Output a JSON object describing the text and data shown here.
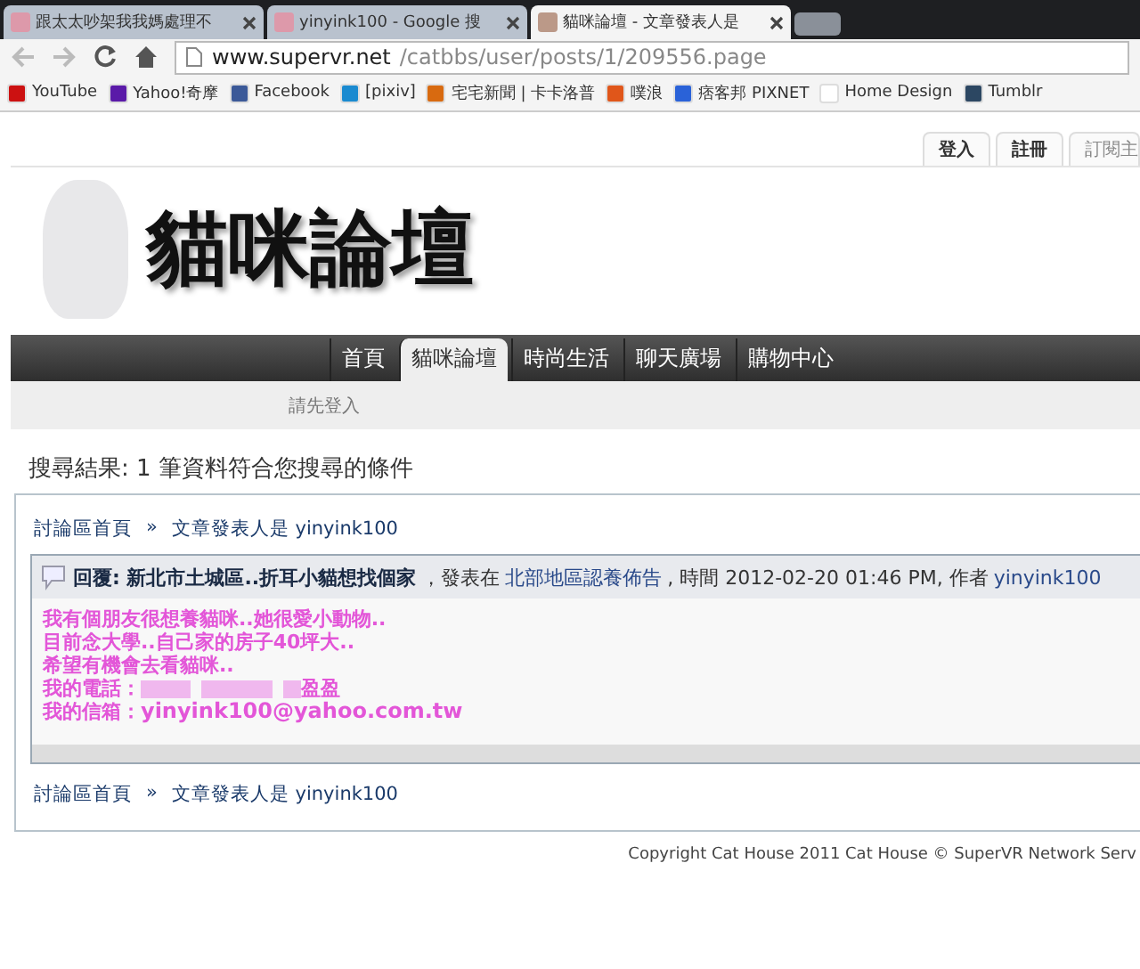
{
  "browser": {
    "tabs": [
      {
        "title": "跟太太吵架我我媽處理不",
        "selected": false
      },
      {
        "title": "yinyink100 - Google 搜",
        "selected": false
      },
      {
        "title": "貓咪論壇 - 文章發表人是",
        "selected": true
      }
    ],
    "address": {
      "host": "www.supervr.net",
      "path": "/catbbs/user/posts/1/209556.page"
    },
    "bookmarks": [
      {
        "label": "YouTube",
        "color": "#cc1111"
      },
      {
        "label": "Yahoo!奇摩",
        "color": "#5a1aa8"
      },
      {
        "label": "Facebook",
        "color": "#3b5998"
      },
      {
        "label": "[pixiv]",
        "color": "#1a8ad0"
      },
      {
        "label": "宅宅新聞 | 卡卡洛普",
        "color": "#d86a10"
      },
      {
        "label": "噗浪",
        "color": "#e0561a"
      },
      {
        "label": "痞客邦 PIXNET",
        "color": "#2a62d8"
      },
      {
        "label": "Home Design",
        "color": "#ffffff"
      },
      {
        "label": "Tumblr",
        "color": "#2c4762"
      }
    ]
  },
  "user_tabs": [
    "登入",
    "註冊",
    "訂閱主"
  ],
  "site_title": "貓咪論壇",
  "nav": [
    {
      "label": "首頁",
      "selected": false
    },
    {
      "label": "貓咪論壇",
      "selected": true
    },
    {
      "label": "時尚生活",
      "selected": false
    },
    {
      "label": "聊天廣場",
      "selected": false
    },
    {
      "label": "購物中心",
      "selected": false
    }
  ],
  "sub_nav": "請先登入",
  "heading": "搜尋結果: 1 筆資料符合您搜尋的條件",
  "breadcrumb": {
    "home": "討論區首頁",
    "separator": "»",
    "current": "文章發表人是 yinyink100"
  },
  "post": {
    "title": "回覆: 新北市土城區..折耳小貓想找個家",
    "posted_in": "，發表在",
    "forum": "北部地區認養佈告",
    "meta": ", 時間 2012-02-20 01:46 PM, 作者",
    "author": "yinyink100",
    "lines": [
      "我有個朋友很想養貓咪..她很愛小動物..",
      "目前念大學..自己家的房子40坪大..",
      "希望有機會去看貓咪.."
    ],
    "phone_label": "我的電話：",
    "phone_suffix": "盈盈",
    "email_label": "我的信箱：",
    "email": "yinyink100@yahoo.com.tw"
  },
  "breadcrumb_bottom": {
    "home": "討論區首頁",
    "separator": "»",
    "current": "文章發表人是 yinyink100"
  },
  "copyright": "Copyright Cat House 2011 Cat House © SuperVR Network Serv"
}
